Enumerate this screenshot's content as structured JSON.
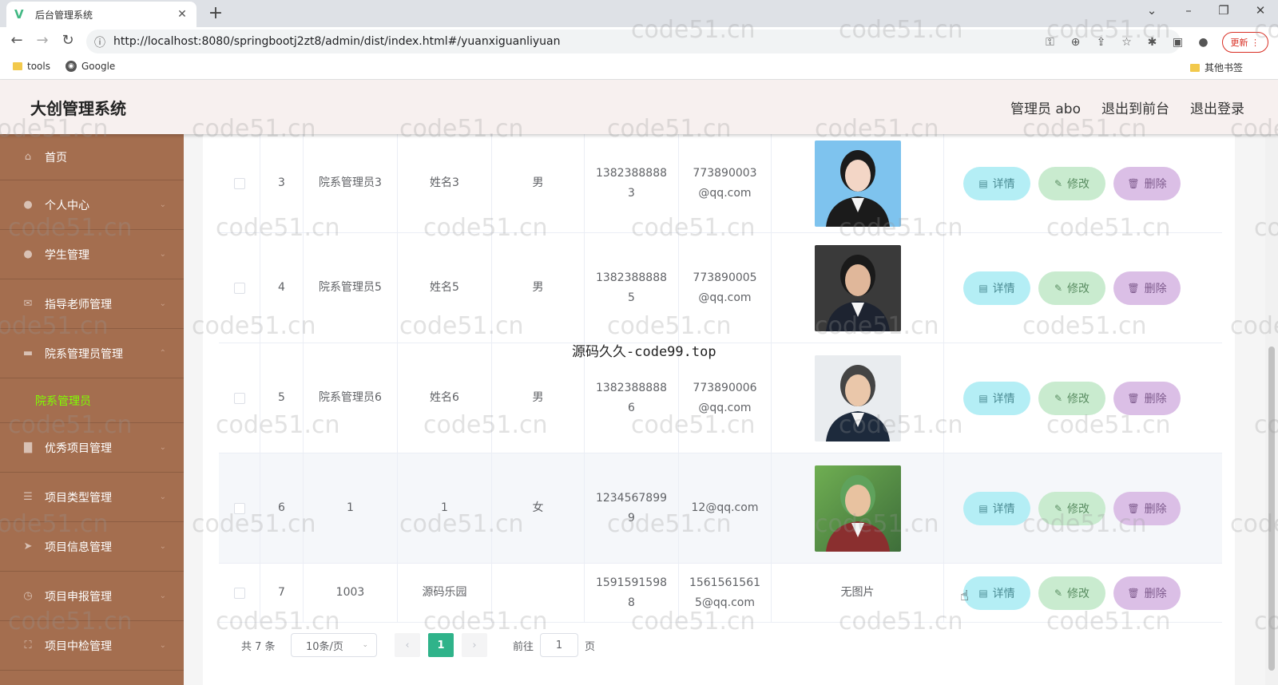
{
  "browser": {
    "tab_title": "后台管理系统",
    "tab_favicon": "V",
    "url": "http://localhost:8080/springbootj2zt8/admin/dist/index.html#/yuanxiguanliyuan",
    "update_label": "更新",
    "bookmarks": [
      "tools",
      "Google"
    ],
    "other_bookmarks": "其他书签"
  },
  "header": {
    "title": "大创管理系统",
    "links": [
      "管理员 abo",
      "退出到前台",
      "退出登录"
    ]
  },
  "sidebar": {
    "items": [
      {
        "label": "首页",
        "icon": "home-icon"
      },
      {
        "label": "个人中心",
        "icon": "user-icon"
      },
      {
        "label": "学生管理",
        "icon": "user-icon"
      },
      {
        "label": "指导老师管理",
        "icon": "mail-icon"
      },
      {
        "label": "院系管理员管理",
        "icon": "chat-icon"
      },
      {
        "label": "优秀项目管理",
        "icon": "briefcase-icon"
      },
      {
        "label": "项目类型管理",
        "icon": "list-icon"
      },
      {
        "label": "项目信息管理",
        "icon": "send-icon"
      },
      {
        "label": "项目申报管理",
        "icon": "clock-icon"
      },
      {
        "label": "项目中检管理",
        "icon": "scan-icon"
      }
    ],
    "sub_item": "院系管理员"
  },
  "table": {
    "rows": [
      {
        "index": "3",
        "account": "院系管理员3",
        "name": "姓名3",
        "gender": "男",
        "phone": [
          "1382388888",
          "3"
        ],
        "email": [
          "773890003",
          "@qq.com"
        ],
        "photo": "avatar-woman"
      },
      {
        "index": "4",
        "account": "院系管理员5",
        "name": "姓名5",
        "gender": "男",
        "phone": [
          "1382388888",
          "5"
        ],
        "email": [
          "773890005",
          "@qq.com"
        ],
        "photo": "avatar-man-suit"
      },
      {
        "index": "5",
        "account": "院系管理员6",
        "name": "姓名6",
        "gender": "男",
        "phone": [
          "1382388888",
          "6"
        ],
        "email": [
          "773890006",
          "@qq.com"
        ],
        "photo": "avatar-man-smile"
      },
      {
        "index": "6",
        "account": "1",
        "name": "1",
        "gender": "女",
        "phone": [
          "1234567899",
          "9"
        ],
        "email": [
          "12@qq.com",
          ""
        ],
        "photo": "avatar-anime"
      },
      {
        "index": "7",
        "account": "1003",
        "name": "源码乐园",
        "gender": "",
        "phone": [
          "1591591598",
          "8"
        ],
        "email": [
          "1561561561",
          "5@qq.com"
        ],
        "photo": "",
        "no_photo": "无图片"
      }
    ],
    "actions": {
      "detail": "详情",
      "edit": "修改",
      "delete": "删除"
    }
  },
  "pagination": {
    "total": "共 7 条",
    "page_size": "10条/页",
    "current_page": "1",
    "goto_prefix": "前往",
    "goto_value": "1",
    "goto_suffix": "页"
  },
  "overlay": {
    "watermark": "code51.cn",
    "center_text": "源码久久-code99.top"
  },
  "colors": {
    "sidebar_bg": "#a46e4f",
    "header_bg": "#f7f0ef",
    "active_submenu": "#7fff00",
    "page_active": "#2fb38a",
    "btn_detail": "#b4eef5",
    "btn_edit": "#c9ebcf",
    "btn_delete": "#dbbfe6"
  }
}
